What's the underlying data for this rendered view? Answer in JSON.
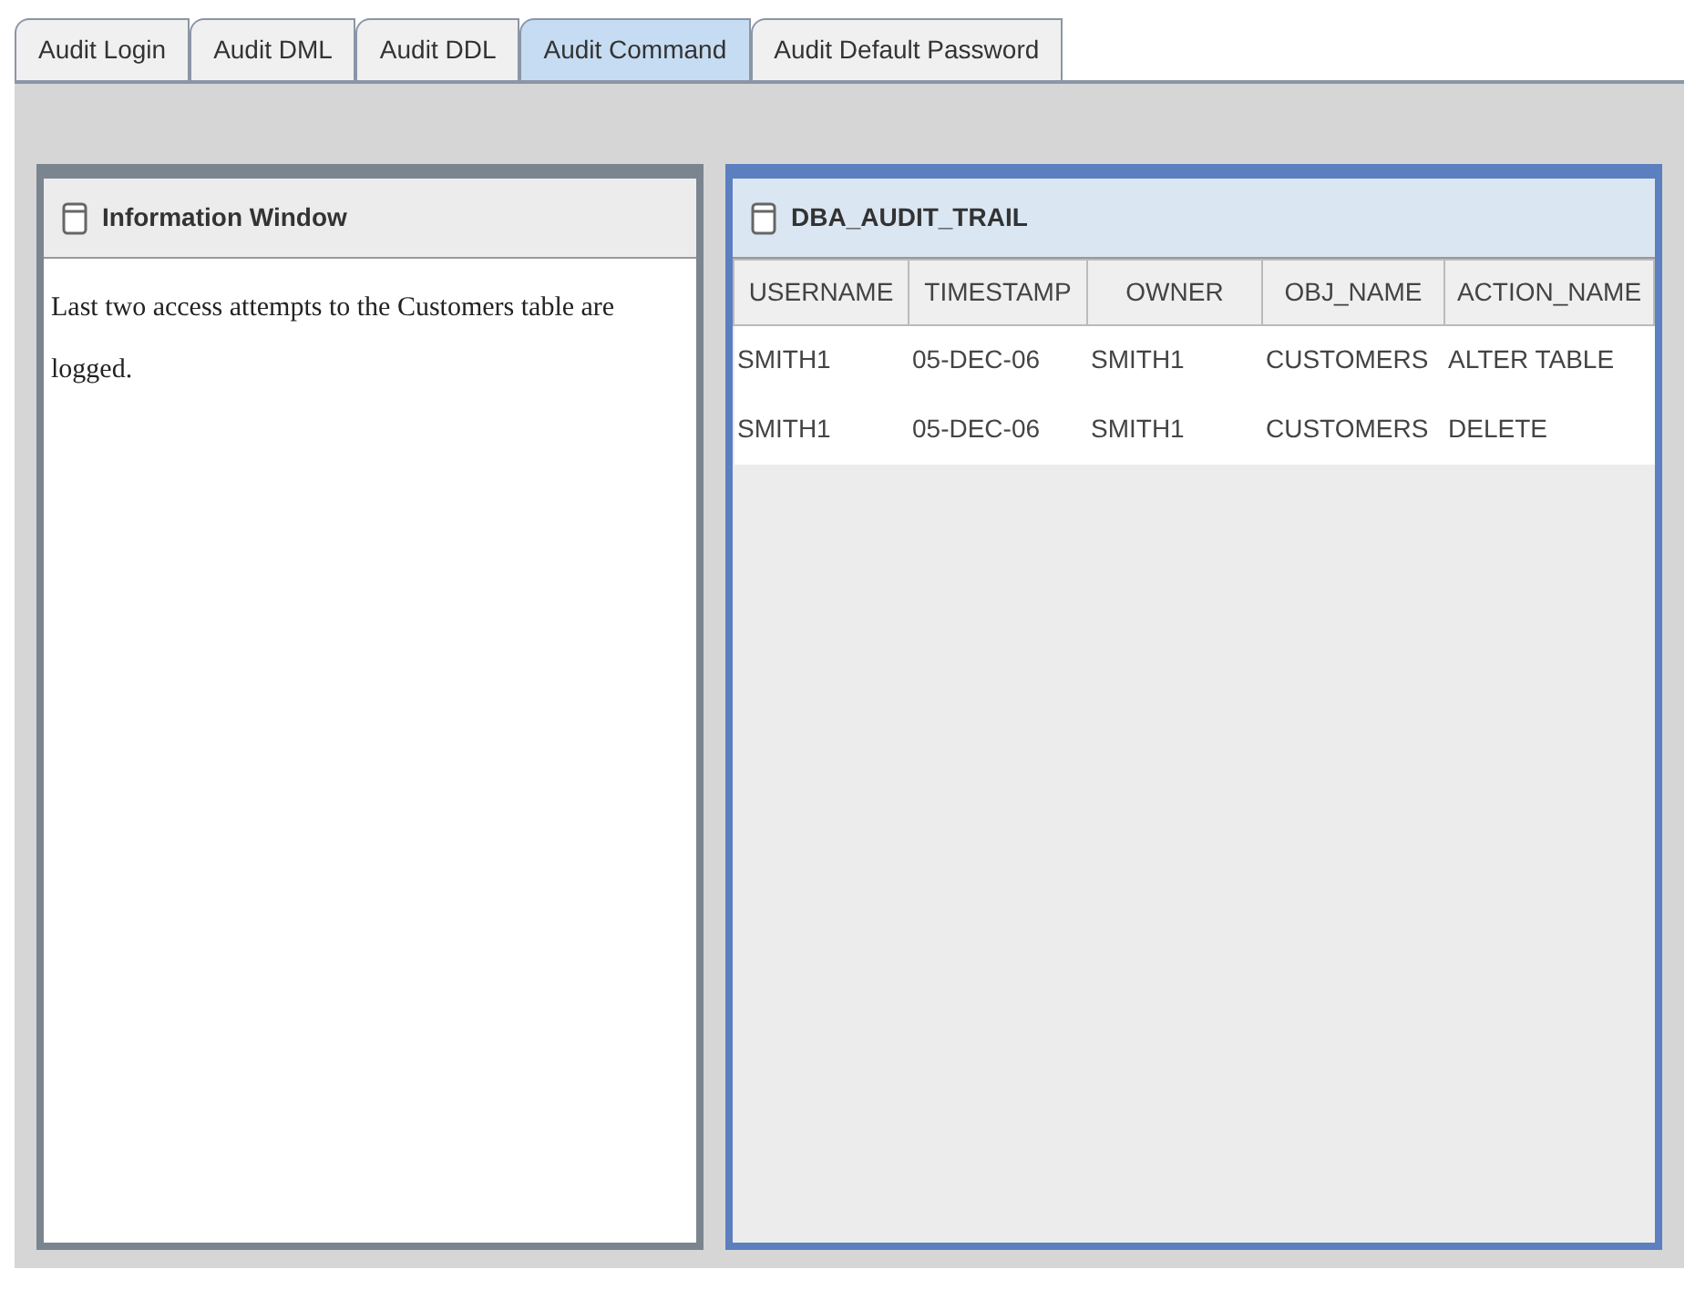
{
  "tabs": [
    {
      "label": "Audit Login",
      "selected": false
    },
    {
      "label": "Audit DML",
      "selected": false
    },
    {
      "label": "Audit DDL",
      "selected": false
    },
    {
      "label": "Audit Command",
      "selected": true
    },
    {
      "label": "Audit Default Password",
      "selected": false
    }
  ],
  "info_panel": {
    "title": "Information Window",
    "active": false,
    "text": "Last two access attempts to the Customers table are logged."
  },
  "table_panel": {
    "title": "DBA_AUDIT_TRAIL",
    "active": true,
    "columns": [
      "USERNAME",
      "TIMESTAMP",
      "OWNER",
      "OBJ_NAME",
      "ACTION_NAME"
    ],
    "rows": [
      [
        "SMITH1",
        "05-DEC-06",
        "SMITH1",
        "CUSTOMERS",
        "ALTER TABLE"
      ],
      [
        "SMITH1",
        "05-DEC-06",
        "SMITH1",
        "CUSTOMERS",
        "DELETE"
      ]
    ]
  }
}
